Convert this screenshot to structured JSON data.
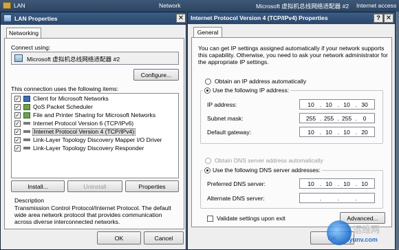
{
  "taskbar": {
    "lan_label": "LAN",
    "network_label": "Network",
    "adapter_label": "Microsoft 虚拟机总线网络适配器 #2",
    "internet_label": "Internet access"
  },
  "lan_window": {
    "title": "LAN Properties",
    "tab": "Networking",
    "connect_using_label": "Connect using:",
    "adapter_name": "Microsoft 虚拟机总线网络适配器 #2",
    "configure_button": "Configure...",
    "items_label": "This connection uses the following items:",
    "items": [
      {
        "label": "Client for Microsoft Networks",
        "checked": true,
        "icon": "network-client-icon"
      },
      {
        "label": "QoS Packet Scheduler",
        "checked": true,
        "icon": "service-icon"
      },
      {
        "label": "File and Printer Sharing for Microsoft Networks",
        "checked": true,
        "icon": "service-icon"
      },
      {
        "label": "Internet Protocol Version 6 (TCP/IPv6)",
        "checked": true,
        "icon": "protocol-icon"
      },
      {
        "label": "Internet Protocol Version 4 (TCP/IPv4)",
        "checked": true,
        "icon": "protocol-icon",
        "selected": true
      },
      {
        "label": "Link-Layer Topology Discovery Mapper I/O Driver",
        "checked": true,
        "icon": "protocol-icon"
      },
      {
        "label": "Link-Layer Topology Discovery Responder",
        "checked": true,
        "icon": "protocol-icon"
      }
    ],
    "install_button": "Install...",
    "uninstall_button": "Uninstall",
    "properties_button": "Properties",
    "description_label": "Description",
    "description_text": "Transmission Control Protocol/Internet Protocol. The default wide area network protocol that provides communication across diverse interconnected networks.",
    "ok_button": "OK",
    "cancel_button": "Cancel"
  },
  "ipv4_window": {
    "title": "Internet Protocol Version 4 (TCP/IPv4) Properties",
    "tab": "General",
    "intro_text": "You can get IP settings assigned automatically if your network supports this capability. Otherwise, you need to ask your network administrator for the appropriate IP settings.",
    "auto_ip_label": "Obtain an IP address automatically",
    "manual_ip_label": "Use the following IP address:",
    "ip_address_label": "IP address:",
    "ip_address": [
      "10",
      "10",
      "10",
      "30"
    ],
    "subnet_label": "Subnet mask:",
    "subnet_mask": [
      "255",
      "255",
      "255",
      "0"
    ],
    "gateway_label": "Default gateway:",
    "gateway": [
      "10",
      "10",
      "10",
      "20"
    ],
    "auto_dns_label": "Obtain DNS server address automatically",
    "manual_dns_label": "Use the following DNS server addresses:",
    "preferred_dns_label": "Preferred DNS server:",
    "preferred_dns": [
      "10",
      "10",
      "10",
      "10"
    ],
    "alternate_dns_label": "Alternate DNS server:",
    "validate_label": "Validate settings upon exit",
    "advanced_button": "Advanced...",
    "ok_button": "OK"
  },
  "watermark": {
    "text": "运维网",
    "url": "iyunv.com"
  }
}
